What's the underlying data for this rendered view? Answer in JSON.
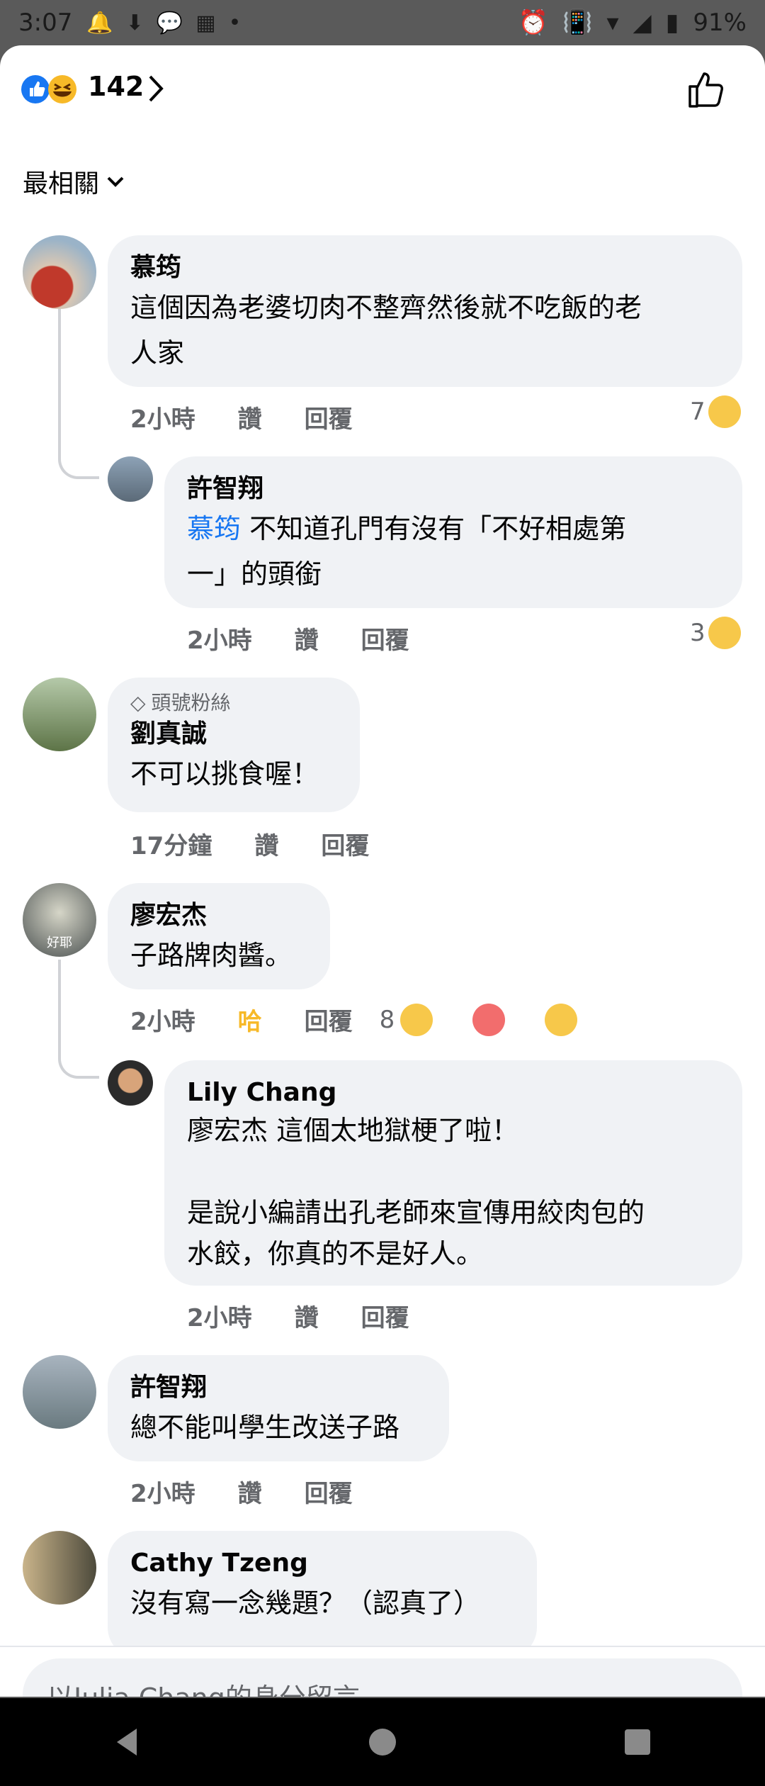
{
  "status": {
    "time": "3:07",
    "battery": "91%"
  },
  "header": {
    "reaction_count": "142"
  },
  "sort": {
    "label": "最相關"
  },
  "comments": [
    {
      "name": "慕筠",
      "text": "這個因為老婆切肉不整齊然後就不吃飯的老\n人家",
      "time": "2小時",
      "like": "讚",
      "reply": "回覆",
      "react_count": "7"
    },
    {
      "name": "許智翔",
      "mention": "慕筠",
      "text": " 不知道孔門有沒有「不好相處第\n一」的頭銜",
      "time": "2小時",
      "like": "讚",
      "reply": "回覆",
      "react_count": "3"
    },
    {
      "badge": "頭號粉絲",
      "name": "劉真誠",
      "text": "不可以挑食喔！",
      "time": "17分鐘",
      "like": "讚",
      "reply": "回覆"
    },
    {
      "name": "廖宏杰",
      "avatar_text": "好耶",
      "text": "子路牌肉醬。",
      "time": "2小時",
      "like": "哈",
      "reply": "回覆",
      "react_count": "8"
    },
    {
      "name": "Lily Chang",
      "text": "廖宏杰 這個太地獄梗了啦！\n\n是說小編請出孔老師來宣傳用絞肉包的\n水餃，你真的不是好人。",
      "time": "2小時",
      "like": "讚",
      "reply": "回覆"
    },
    {
      "name": "許智翔",
      "text": "總不能叫學生改送子路",
      "time": "2小時",
      "like": "讚",
      "reply": "回覆"
    },
    {
      "name": "Cathy  Tzeng",
      "text": "沒有寫一念幾題？（認真了）"
    }
  ],
  "composer": {
    "placeholder": "以Julia Chang的身分留言"
  },
  "colors": {
    "accent": "#1877f2",
    "bubble": "#f0f2f5",
    "meta": "#65676b",
    "haha": "#f7b928"
  }
}
